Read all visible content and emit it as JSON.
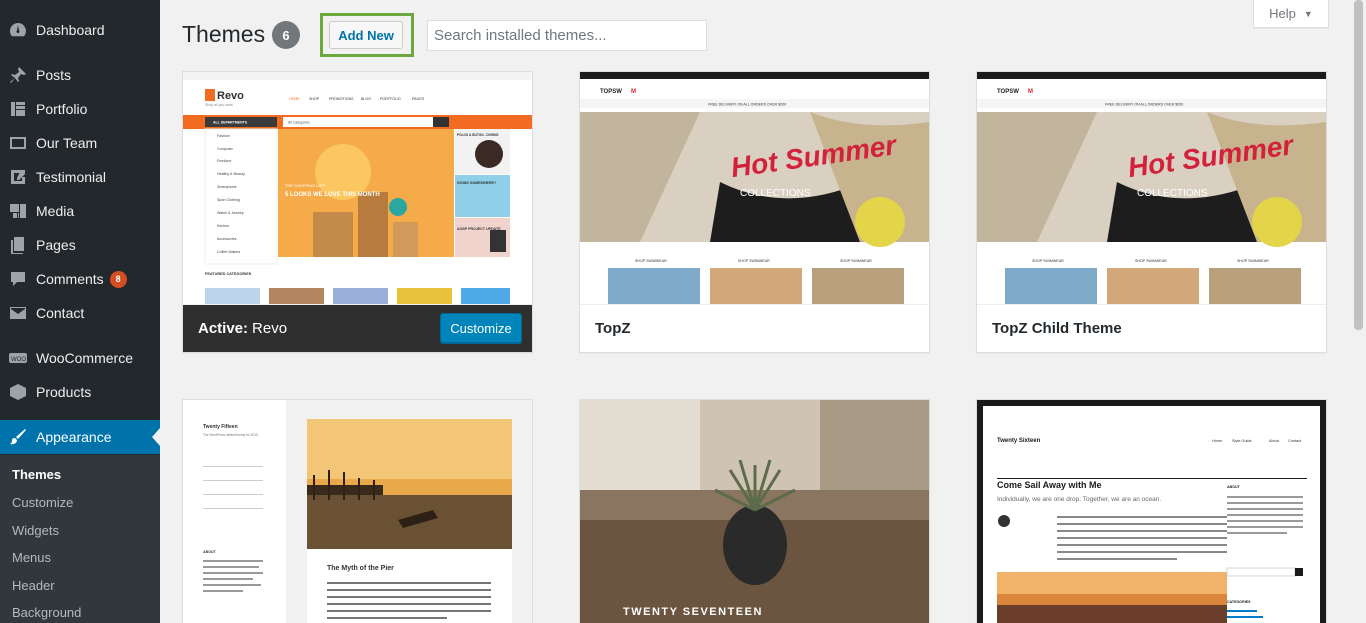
{
  "sidebar": {
    "items": [
      {
        "label": "Dashboard",
        "icon": "dashboard-icon"
      },
      {
        "label": "Posts",
        "icon": "pushpin-icon"
      },
      {
        "label": "Portfolio",
        "icon": "portfolio-icon"
      },
      {
        "label": "Our Team",
        "icon": "team-icon"
      },
      {
        "label": "Testimonial",
        "icon": "testimonial-icon"
      },
      {
        "label": "Media",
        "icon": "media-icon"
      },
      {
        "label": "Pages",
        "icon": "pages-icon"
      },
      {
        "label": "Comments",
        "icon": "comment-icon",
        "badge": "8"
      },
      {
        "label": "Contact",
        "icon": "mail-icon"
      },
      {
        "label": "WooCommerce",
        "icon": "woocommerce-icon"
      },
      {
        "label": "Products",
        "icon": "products-icon"
      },
      {
        "label": "Appearance",
        "icon": "paintbrush-icon"
      }
    ],
    "submenu": [
      "Themes",
      "Customize",
      "Widgets",
      "Menus",
      "Header",
      "Background"
    ]
  },
  "header": {
    "title": "Themes",
    "count": "6",
    "add_new_label": "Add New",
    "search_placeholder": "Search installed themes...",
    "help_label": "Help"
  },
  "themes": [
    {
      "name": "Revo",
      "active_prefix": "Active:",
      "customize_label": "Customize"
    },
    {
      "name": "TopZ"
    },
    {
      "name": "TopZ Child Theme"
    },
    {
      "name": "Twenty Fifteen"
    },
    {
      "name": "Twenty Seventeen"
    },
    {
      "name": "Twenty Sixteen"
    }
  ],
  "screenshots": {
    "revo": {
      "logo": "Revo",
      "tagline": "Shop all you want",
      "nav": [
        "HOME",
        "SHOP",
        "PROMOTIONS",
        "BLOG",
        "PORTFOLIO",
        "PAGES"
      ],
      "departments": "ALL DEPARTMENTS",
      "categories": [
        "Fashion",
        "Computer",
        "Furniture",
        "Healthy & Beauty",
        "Smartphone",
        "Sport Clothing",
        "Watch & Jewelry",
        "Kitchen",
        "Accessories",
        "Coffee Makers"
      ],
      "search_cat": "All Categories",
      "banner_small": "THE SHOPPING LIST",
      "banner_big": "5 LOOKS WE LOVE THIS MONTH",
      "side1": "POLOS & BUTON - DOWNS",
      "side2": "GOING SOMEWHERE?",
      "side3": "AOSP PROJECT UPDATE",
      "featured": "FEATURED CATEGORIES"
    },
    "topz": {
      "logo_a": "TOPSW",
      "logo_b": "M",
      "free_delivery": "FREE DELIVERY ON ALL ORDERS OVER $200",
      "hero_script": "Hot Summer",
      "hero_sub": "COLLECTIONS",
      "shop_label": "SHOP SWIMWEAR"
    },
    "fifteen": {
      "site_title": "Twenty Fifteen",
      "site_desc": "The WordPress default theme for 2015.",
      "post_title": "The Myth of the Pier",
      "post_text": "Arrived after the fashion of the Middle Ages, they bore upon their shoulders a splendid pair of wings; but what especially distinguished them was the long noses which were fastened to their faces, and the uses which they made of them.",
      "about": "ABOUT"
    },
    "seventeen": {
      "title": "TWENTY SEVENTEEN"
    },
    "sixteen": {
      "site_title": "Twenty Sixteen",
      "nav": [
        "Home",
        "Style Guide",
        "About",
        "Contact"
      ],
      "post_title": "Come Sail Away with Me",
      "post_lead": "Individually, we are one drop. Together, we are an ocean.",
      "about": "ABOUT",
      "categories": "CATEGORIES"
    }
  },
  "colors": {
    "sidebar_bg": "#23282d",
    "active_menu": "#0073aa",
    "add_new_highlight": "#6da83f",
    "customize_button": "#0085ba",
    "revo_orange": "#f36b21"
  }
}
